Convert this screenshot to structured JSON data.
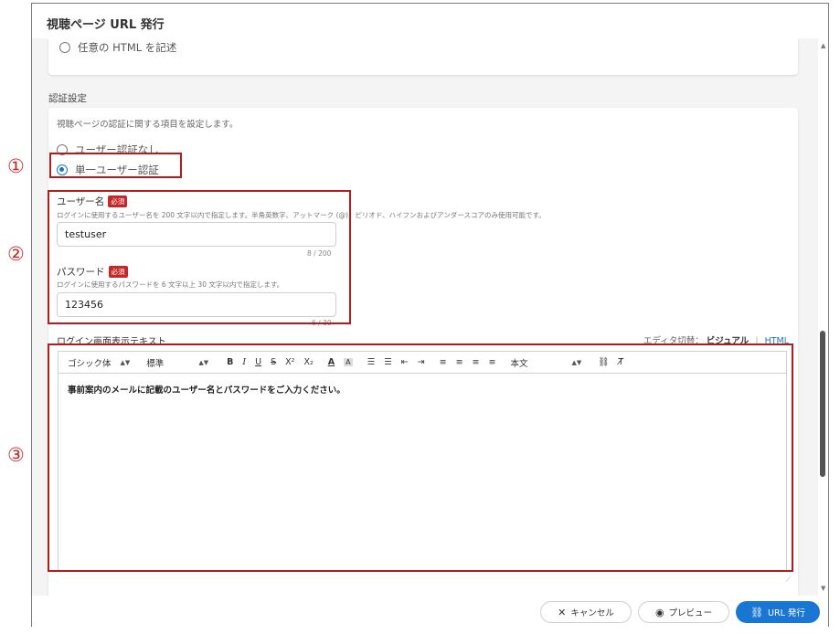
{
  "dialog": {
    "title": "視聴ページ URL 発行"
  },
  "top_card": {
    "radio_custom_html": "任意の HTML を記述"
  },
  "auth": {
    "section_label": "認証設定",
    "description": "視聴ページの認証に関する項目を設定します。",
    "radio_none": "ユーザー認証なし",
    "radio_single": "単一ユーザー認証",
    "username": {
      "label": "ユーザー名",
      "required": "必須",
      "help": "ログインに使用するユーザー名を 200 文字以内で指定します。半角英数字、アットマーク (@)、ピリオド、ハイフンおよびアンダースコアのみ使用可能です。",
      "value": "testuser",
      "counter": "8 / 200"
    },
    "password": {
      "label": "パスワード",
      "required": "必須",
      "help": "ログインに使用するパスワードを 6 文字以上 30 文字以内で指定します。",
      "value": "123456",
      "counter": "6 / 30"
    }
  },
  "login_text": {
    "label": "ログイン画面表示テキスト",
    "editor_switch_label": "エディタ切替：",
    "mode_visual": "ビジュアル",
    "mode_separator": "|",
    "mode_html": "HTML",
    "toolbar": {
      "font": "ゴシック体",
      "size": "標準",
      "bold": "B",
      "italic": "I",
      "underline": "U",
      "strike": "S",
      "superscript": "X²",
      "subscript": "X₂",
      "font_color": "A",
      "bg_color": "A",
      "block": "本文"
    },
    "content": "事前案内のメールに記載のユーザー名とパスワードをご入力ください。"
  },
  "footer": {
    "cancel": "キャンセル",
    "preview": "プレビュー",
    "issue": "URL 発行"
  },
  "annotations": {
    "n1": "①",
    "n2": "②",
    "n3": "③"
  },
  "colors": {
    "accent": "#1976d2",
    "annotation": "#c62828"
  }
}
